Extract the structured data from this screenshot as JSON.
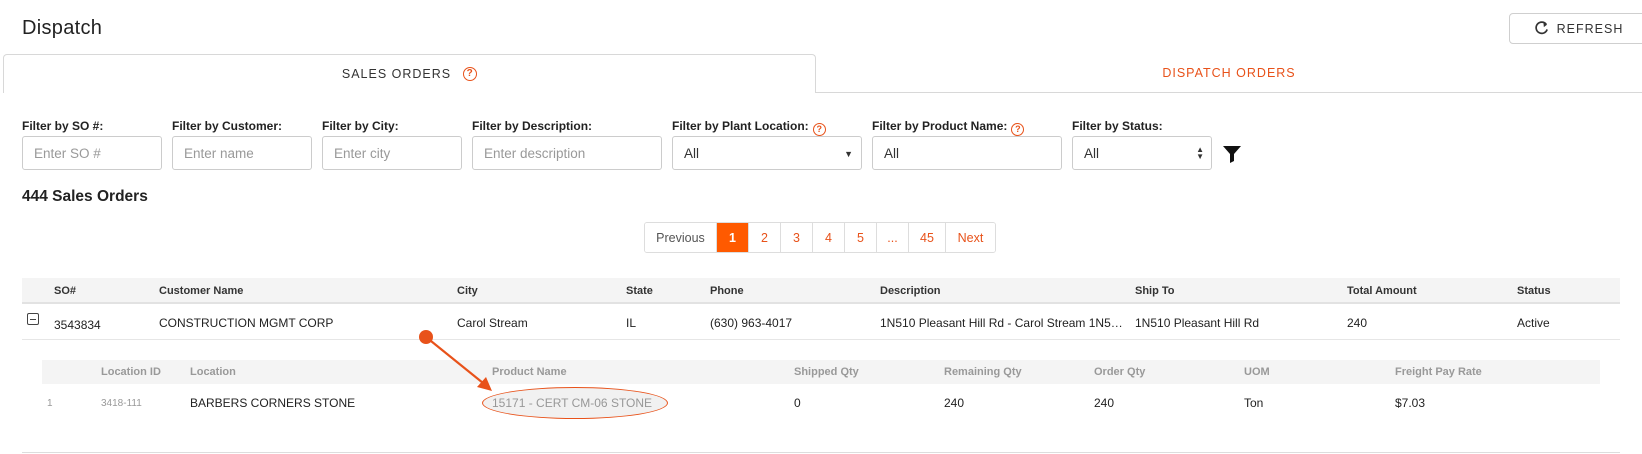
{
  "header": {
    "title": "Dispatch",
    "refresh_label": "REFRESH"
  },
  "tabs": {
    "sales": "SALES ORDERS",
    "dispatch": "DISPATCH ORDERS",
    "help": "?"
  },
  "filters": {
    "so_label": "Filter by SO #:",
    "so_placeholder": "Enter SO #",
    "customer_label": "Filter by Customer:",
    "customer_placeholder": "Enter name",
    "city_label": "Filter by City:",
    "city_placeholder": "Enter city",
    "description_label": "Filter by Description:",
    "description_placeholder": "Enter description",
    "plant_label": "Filter by Plant Location:",
    "plant_value": "All",
    "product_label": "Filter by Product Name:",
    "product_value": "All",
    "status_label": "Filter by Status:",
    "status_value": "All",
    "help": "?"
  },
  "orders": {
    "count_title": "444 Sales Orders"
  },
  "pagination": {
    "previous": "Previous",
    "pages": [
      "1",
      "2",
      "3",
      "4",
      "5",
      "...",
      "45"
    ],
    "next": "Next",
    "active": "1"
  },
  "table": {
    "headers": [
      "SO#",
      "Customer Name",
      "City",
      "State",
      "Phone",
      "Description",
      "Ship To",
      "Total Amount",
      "Status"
    ],
    "row": {
      "so": "3543834",
      "customer": "CONSTRUCTION MGMT CORP",
      "city": "Carol Stream",
      "state": "IL",
      "phone": "(630) 963-4017",
      "description": "1N510 Pleasant Hill Rd - Carol Stream 1N5…",
      "ship_to": "1N510 Pleasant Hill Rd",
      "total": "240",
      "status": "Active"
    }
  },
  "subtable": {
    "headers": [
      "Location ID",
      "Location",
      "Product Name",
      "Shipped Qty",
      "Remaining Qty",
      "Order Qty",
      "UOM",
      "Freight Pay Rate"
    ],
    "row": {
      "index": "1",
      "location_id": "3418-111",
      "location": "BARBERS CORNERS STONE",
      "product": "15171 - CERT CM-06 STONE",
      "shipped": "0",
      "remaining": "240",
      "order_qty": "240",
      "uom": "Ton",
      "freight": "$7.03"
    }
  },
  "colors": {
    "accent": "#e8521a",
    "active_page": "#ff5a00"
  }
}
